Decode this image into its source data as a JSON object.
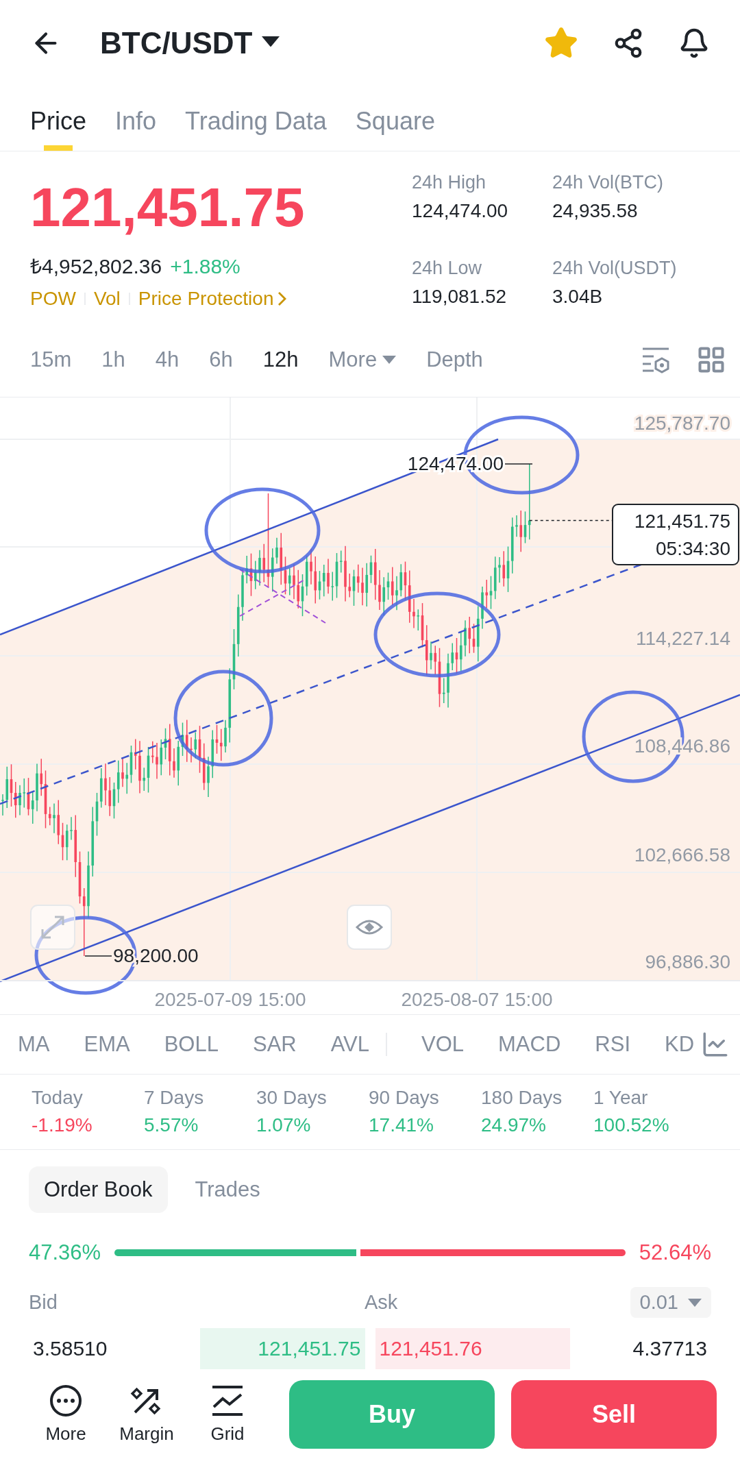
{
  "header": {
    "title": "BTC/USDT",
    "favorite": true
  },
  "tabs": [
    {
      "label": "Price",
      "selected": true
    },
    {
      "label": "Info",
      "selected": false
    },
    {
      "label": "Trading Data",
      "selected": false
    },
    {
      "label": "Square",
      "selected": false
    }
  ],
  "ticker": {
    "price": "121,451.75",
    "local_price": "₺4,952,802.36",
    "change": "+1.88%",
    "tags": [
      "POW",
      "Vol",
      "Price Protection"
    ]
  },
  "stats": [
    {
      "label": "24h High",
      "value": "124,474.00"
    },
    {
      "label": "24h Vol(BTC)",
      "value": "24,935.58"
    },
    {
      "label": "24h Low",
      "value": "119,081.52"
    },
    {
      "label": "24h Vol(USDT)",
      "value": "3.04B"
    }
  ],
  "intervals": [
    {
      "label": "15m",
      "kind": "interval",
      "selected": false
    },
    {
      "label": "1h",
      "kind": "interval",
      "selected": false
    },
    {
      "label": "4h",
      "kind": "interval",
      "selected": false
    },
    {
      "label": "6h",
      "kind": "interval",
      "selected": false
    },
    {
      "label": "12h",
      "kind": "interval",
      "selected": true
    },
    {
      "label": "More",
      "kind": "menu",
      "selected": false
    },
    {
      "label": "Depth",
      "kind": "view",
      "selected": false
    }
  ],
  "chart": {
    "price_labels": [
      "125,787.70",
      "114,227.14",
      "108,446.86",
      "102,666.58",
      "96,886.30"
    ],
    "date_labels": [
      "2025-07-09 15:00",
      "2025-08-07 15:00"
    ],
    "high_label": "124,474.00",
    "low_label": "98,200.00",
    "last_price": "121,451.75",
    "countdown": "05:34:30"
  },
  "main_indicators": [
    "MA",
    "EMA",
    "BOLL",
    "SAR",
    "AVL"
  ],
  "sub_indicators": [
    "VOL",
    "MACD",
    "RSI",
    "KD"
  ],
  "performance": [
    {
      "label": "Today",
      "value": "-1.19%",
      "color": "#f6465d"
    },
    {
      "label": "7 Days",
      "value": "5.57%",
      "color": "#2ebd85"
    },
    {
      "label": "30 Days",
      "value": "1.07%",
      "color": "#2ebd85"
    },
    {
      "label": "90 Days",
      "value": "17.41%",
      "color": "#2ebd85"
    },
    {
      "label": "180 Days",
      "value": "24.97%",
      "color": "#2ebd85"
    },
    {
      "label": "1 Year",
      "value": "100.52%",
      "color": "#2ebd85"
    }
  ],
  "order_book": {
    "tabs": [
      {
        "label": "Order Book",
        "selected": true
      },
      {
        "label": "Trades",
        "selected": false
      }
    ],
    "bid_share": "47.36%",
    "ask_share": "52.64%",
    "bid_heading": "Bid",
    "ask_heading": "Ask",
    "precision": "0.01",
    "rows": [
      {
        "bid": {
          "qty": "3.58510",
          "price": "121,451.75"
        },
        "ask": {
          "price": "121,451.76",
          "qty": "4.37713"
        }
      }
    ]
  },
  "actions": [
    {
      "label": "More",
      "kind": "more"
    },
    {
      "label": "Margin",
      "kind": "margin"
    },
    {
      "label": "Grid",
      "kind": "grid"
    }
  ],
  "trade_buttons": [
    {
      "label": "Buy",
      "kind": "buy"
    },
    {
      "label": "Sell",
      "kind": "sell"
    }
  ]
}
